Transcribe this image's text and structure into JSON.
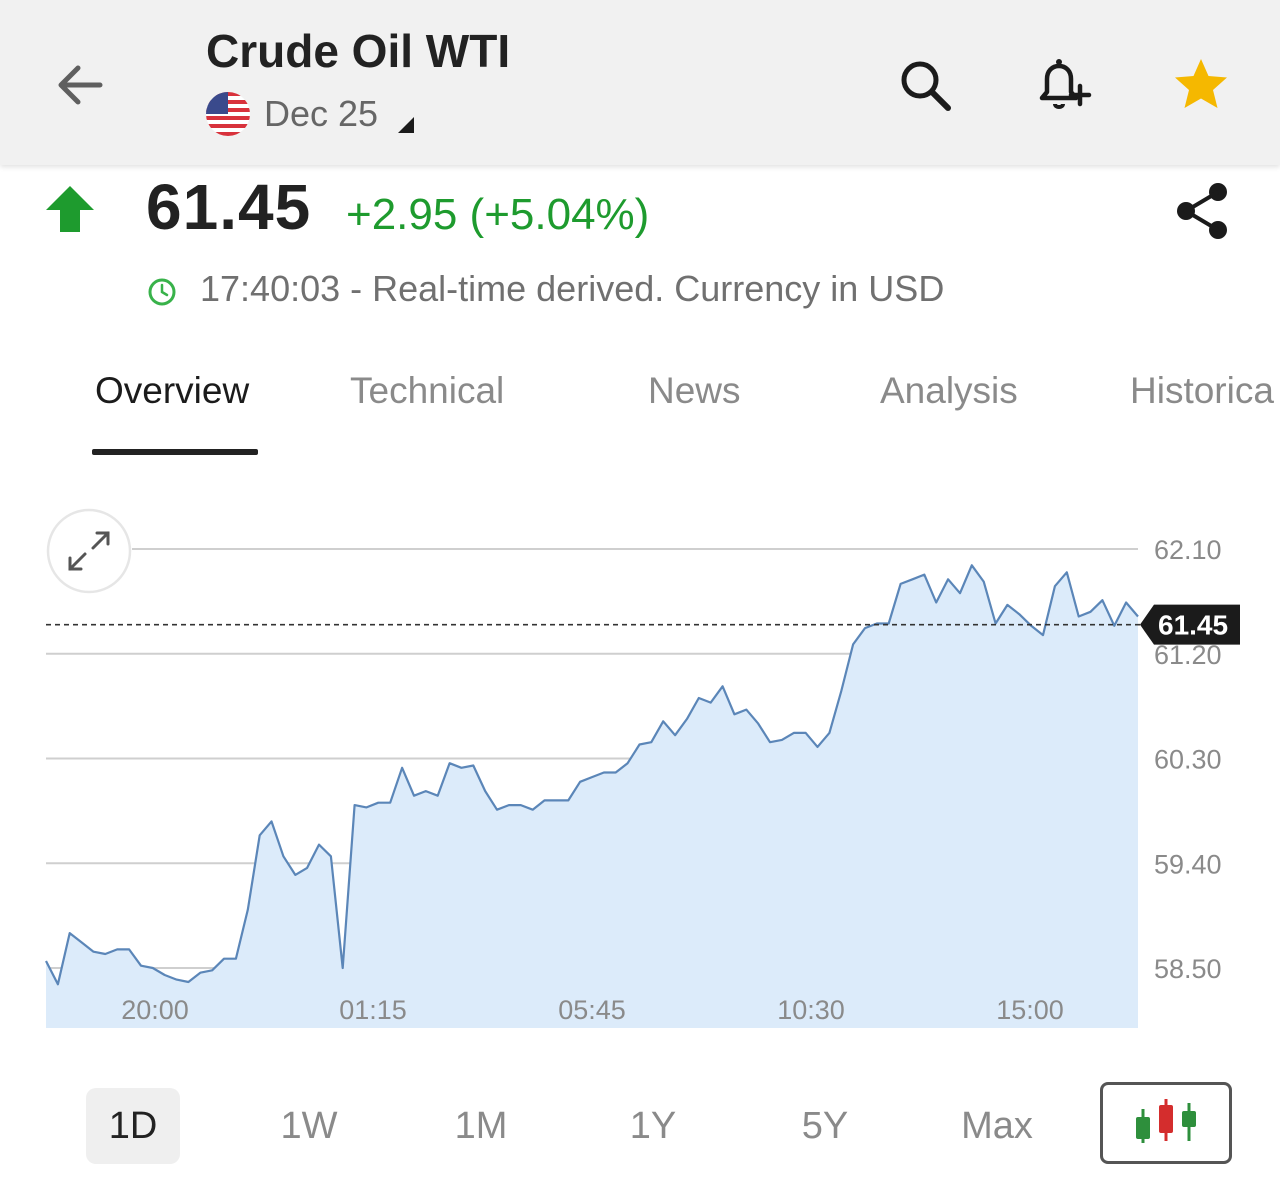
{
  "header": {
    "title": "Crude Oil WTI",
    "contract": "Dec 25",
    "icons": [
      "back-arrow-icon",
      "us-flag-icon",
      "search-icon",
      "add-alert-icon",
      "star-icon"
    ],
    "star_color": "#F5B800"
  },
  "quote": {
    "price": "61.45",
    "change": "+2.95 (+5.04%)",
    "status": "17:40:03 - Real-time derived. Currency in USD",
    "up_color": "#1E9B2E"
  },
  "tabs": [
    {
      "label": "Overview",
      "active": true
    },
    {
      "label": "Technical",
      "active": false
    },
    {
      "label": "News",
      "active": false
    },
    {
      "label": "Analysis",
      "active": false
    },
    {
      "label": "Historica",
      "active": false
    }
  ],
  "chart_data": {
    "type": "area",
    "y_ticks": [
      "62.10",
      "61.20",
      "60.30",
      "59.40",
      "58.50"
    ],
    "x_ticks": [
      "20:00",
      "01:15",
      "05:45",
      "10:30",
      "15:00"
    ],
    "ylim": [
      58.0,
      62.4
    ],
    "current_value": 61.45,
    "current_label": "61.45",
    "line_color": "#5B86B8",
    "fill_color": "#DCEBFA",
    "series": [
      {
        "values": [
          58.56,
          58.36,
          58.8,
          58.72,
          58.64,
          58.62,
          58.66,
          58.66,
          58.52,
          58.5,
          58.44,
          58.4,
          58.38,
          58.46,
          58.48,
          58.58,
          58.58,
          59.0,
          59.64,
          59.76,
          59.46,
          59.3,
          59.36,
          59.56,
          59.46,
          58.5,
          59.9,
          59.88,
          59.92,
          59.92,
          60.22,
          59.98,
          60.02,
          59.98,
          60.26,
          60.22,
          60.24,
          60.02,
          59.86,
          59.9,
          59.9,
          59.86,
          59.94,
          59.94,
          59.94,
          60.1,
          60.14,
          60.18,
          60.18,
          60.26,
          60.42,
          60.44,
          60.62,
          60.5,
          60.64,
          60.82,
          60.78,
          60.92,
          60.68,
          60.72,
          60.6,
          60.44,
          60.46,
          60.52,
          60.52,
          60.4,
          60.52,
          60.88,
          61.28,
          61.42,
          61.46,
          61.46,
          61.8,
          61.84,
          61.88,
          61.64,
          61.84,
          61.72,
          61.96,
          61.82,
          61.46,
          61.62,
          61.54,
          61.44,
          61.36,
          61.78,
          61.9,
          61.52,
          61.56,
          61.66,
          61.44,
          61.64,
          61.52
        ]
      }
    ]
  },
  "ranges": [
    {
      "label": "1D",
      "active": true
    },
    {
      "label": "1W",
      "active": false
    },
    {
      "label": "1M",
      "active": false
    },
    {
      "label": "1Y",
      "active": false
    },
    {
      "label": "5Y",
      "active": false
    },
    {
      "label": "Max",
      "active": false
    }
  ]
}
